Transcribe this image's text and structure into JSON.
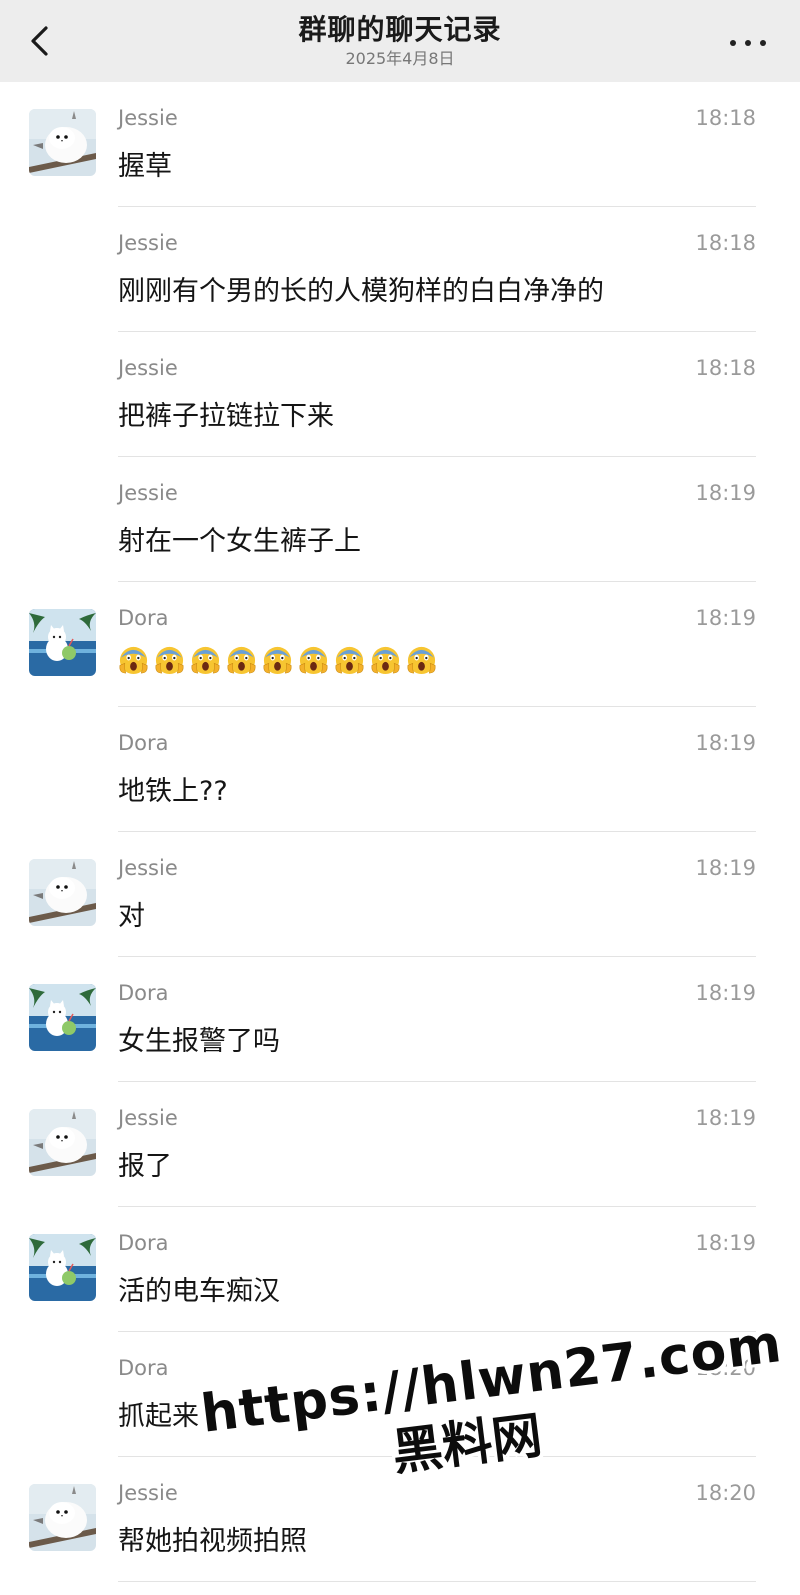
{
  "header": {
    "title": "群聊的聊天记录",
    "date": "2025年4月8日",
    "back_icon": "chevron-left-icon",
    "more_icon": "more-horizontal-icon"
  },
  "colors": {
    "header_bg": "#ededed",
    "jessie_avatar_bg": "#d7e3ea",
    "dora_avatar_bg": "#1f5e96"
  },
  "messages": [
    {
      "sender": "Jessie",
      "time": "18:18",
      "text": "握草",
      "avatar": "jessie"
    },
    {
      "sender": "Jessie",
      "time": "18:18",
      "text": "刚刚有个男的长的人模狗样的白白净净的",
      "avatar": null
    },
    {
      "sender": "Jessie",
      "time": "18:18",
      "text": "把裤子拉链拉下来",
      "avatar": null
    },
    {
      "sender": "Jessie",
      "time": "18:19",
      "text": "射在一个女生裤子上",
      "avatar": null
    },
    {
      "sender": "Dora",
      "time": "18:19",
      "text": "",
      "emoji": "screaming-face-emoji",
      "emoji_count": 9,
      "avatar": "dora"
    },
    {
      "sender": "Dora",
      "time": "18:19",
      "text": "地铁上??",
      "avatar": null
    },
    {
      "sender": "Jessie",
      "time": "18:19",
      "text": "对",
      "avatar": "jessie"
    },
    {
      "sender": "Dora",
      "time": "18:19",
      "text": "女生报警了吗",
      "avatar": "dora"
    },
    {
      "sender": "Jessie",
      "time": "18:19",
      "text": "报了",
      "avatar": "jessie"
    },
    {
      "sender": "Dora",
      "time": "18:19",
      "text": "活的电车痴汉",
      "avatar": "dora"
    },
    {
      "sender": "Dora",
      "time": "18:20",
      "text": "抓起来",
      "avatar": null
    },
    {
      "sender": "Jessie",
      "time": "18:20",
      "text": "帮她拍视频拍照",
      "avatar": "jessie"
    }
  ],
  "watermark": {
    "url": "https://hlwn27.com",
    "name": "黑料网"
  }
}
